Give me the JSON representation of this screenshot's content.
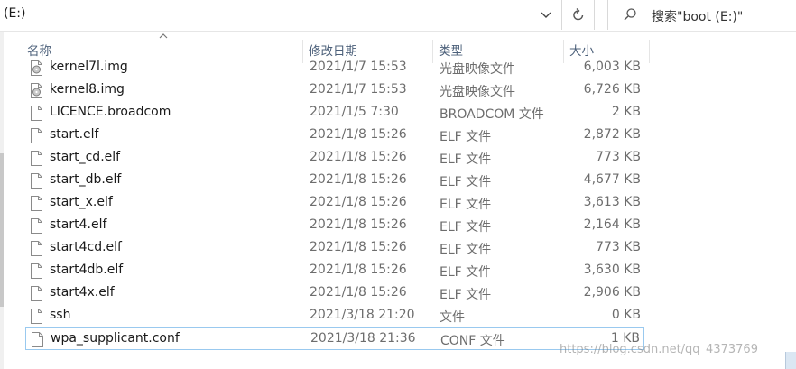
{
  "address": {
    "path": "(E:)"
  },
  "search": {
    "placeholder": "搜索\"boot (E:)\""
  },
  "columns": {
    "name": "名称",
    "modified": "修改日期",
    "type": "类型",
    "size": "大小"
  },
  "files": [
    {
      "name": "kernel7l.img",
      "modified": "2021/1/7 15:53",
      "type": "光盘映像文件",
      "size": "6,003 KB",
      "icon": "disc-image-icon"
    },
    {
      "name": "kernel8.img",
      "modified": "2021/1/7 15:53",
      "type": "光盘映像文件",
      "size": "6,726 KB",
      "icon": "disc-image-icon"
    },
    {
      "name": "LICENCE.broadcom",
      "modified": "2021/1/5 7:30",
      "type": "BROADCOM 文件",
      "size": "2 KB",
      "icon": "file-icon"
    },
    {
      "name": "start.elf",
      "modified": "2021/1/8 15:26",
      "type": "ELF 文件",
      "size": "2,872 KB",
      "icon": "file-icon"
    },
    {
      "name": "start_cd.elf",
      "modified": "2021/1/8 15:26",
      "type": "ELF 文件",
      "size": "773 KB",
      "icon": "file-icon"
    },
    {
      "name": "start_db.elf",
      "modified": "2021/1/8 15:26",
      "type": "ELF 文件",
      "size": "4,677 KB",
      "icon": "file-icon"
    },
    {
      "name": "start_x.elf",
      "modified": "2021/1/8 15:26",
      "type": "ELF 文件",
      "size": "3,613 KB",
      "icon": "file-icon"
    },
    {
      "name": "start4.elf",
      "modified": "2021/1/8 15:26",
      "type": "ELF 文件",
      "size": "2,164 KB",
      "icon": "file-icon"
    },
    {
      "name": "start4cd.elf",
      "modified": "2021/1/8 15:26",
      "type": "ELF 文件",
      "size": "773 KB",
      "icon": "file-icon"
    },
    {
      "name": "start4db.elf",
      "modified": "2021/1/8 15:26",
      "type": "ELF 文件",
      "size": "3,630 KB",
      "icon": "file-icon"
    },
    {
      "name": "start4x.elf",
      "modified": "2021/1/8 15:26",
      "type": "ELF 文件",
      "size": "2,906 KB",
      "icon": "file-icon"
    },
    {
      "name": "ssh",
      "modified": "2021/3/18 21:20",
      "type": "文件",
      "size": "0 KB",
      "icon": "file-icon"
    },
    {
      "name": "wpa_supplicant.conf",
      "modified": "2021/3/18 21:36",
      "type": "CONF 文件",
      "size": "1 KB",
      "icon": "file-icon",
      "selected": true
    }
  ],
  "watermark": "https://blog.csdn.net/qq_4373769"
}
